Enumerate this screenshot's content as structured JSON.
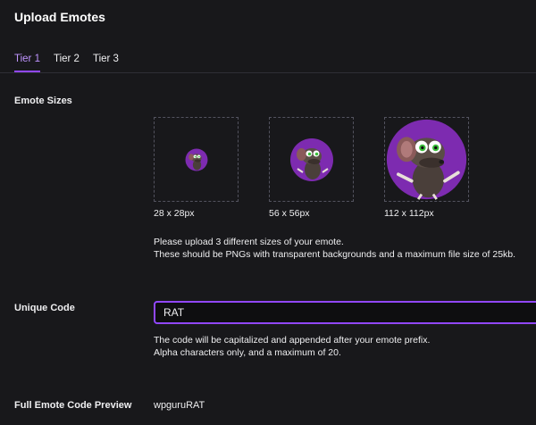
{
  "header": {
    "title": "Upload Emotes"
  },
  "tabs": [
    {
      "label": "Tier 1",
      "active": true
    },
    {
      "label": "Tier 2",
      "active": false
    },
    {
      "label": "Tier 3",
      "active": false
    }
  ],
  "emote_sizes": {
    "label": "Emote Sizes",
    "slots": [
      {
        "size_label": "28 x 28px"
      },
      {
        "size_label": "56 x 56px"
      },
      {
        "size_label": "112 x 112px"
      }
    ],
    "help_line1": "Please upload 3 different sizes of your emote.",
    "help_line2": "These should be PNGs with transparent backgrounds and a maximum file size of 25kb."
  },
  "unique_code": {
    "label": "Unique Code",
    "value": "RAT",
    "help_line1": "The code will be capitalized and appended after your emote prefix.",
    "help_line2": "Alpha characters only, and a maximum of 20."
  },
  "preview": {
    "label": "Full Emote Code Preview",
    "value": "wpguruRAT"
  },
  "colors": {
    "background": "#18181b",
    "accent": "#9147ff",
    "active_tab": "#bf94ff",
    "emote_circle": "#7d2bb0"
  }
}
